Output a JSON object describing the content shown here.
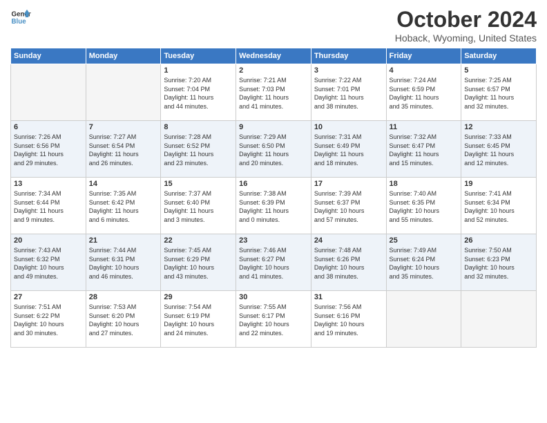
{
  "header": {
    "logo_general": "General",
    "logo_blue": "Blue",
    "month": "October 2024",
    "location": "Hoback, Wyoming, United States"
  },
  "weekdays": [
    "Sunday",
    "Monday",
    "Tuesday",
    "Wednesday",
    "Thursday",
    "Friday",
    "Saturday"
  ],
  "weeks": [
    [
      {
        "day": "",
        "sunrise": "",
        "sunset": "",
        "daylight": "",
        "empty": true
      },
      {
        "day": "",
        "sunrise": "",
        "sunset": "",
        "daylight": "",
        "empty": true
      },
      {
        "day": "1",
        "sunrise": "Sunrise: 7:20 AM",
        "sunset": "Sunset: 7:04 PM",
        "daylight": "Daylight: 11 hours and 44 minutes."
      },
      {
        "day": "2",
        "sunrise": "Sunrise: 7:21 AM",
        "sunset": "Sunset: 7:03 PM",
        "daylight": "Daylight: 11 hours and 41 minutes."
      },
      {
        "day": "3",
        "sunrise": "Sunrise: 7:22 AM",
        "sunset": "Sunset: 7:01 PM",
        "daylight": "Daylight: 11 hours and 38 minutes."
      },
      {
        "day": "4",
        "sunrise": "Sunrise: 7:24 AM",
        "sunset": "Sunset: 6:59 PM",
        "daylight": "Daylight: 11 hours and 35 minutes."
      },
      {
        "day": "5",
        "sunrise": "Sunrise: 7:25 AM",
        "sunset": "Sunset: 6:57 PM",
        "daylight": "Daylight: 11 hours and 32 minutes."
      }
    ],
    [
      {
        "day": "6",
        "sunrise": "Sunrise: 7:26 AM",
        "sunset": "Sunset: 6:56 PM",
        "daylight": "Daylight: 11 hours and 29 minutes."
      },
      {
        "day": "7",
        "sunrise": "Sunrise: 7:27 AM",
        "sunset": "Sunset: 6:54 PM",
        "daylight": "Daylight: 11 hours and 26 minutes."
      },
      {
        "day": "8",
        "sunrise": "Sunrise: 7:28 AM",
        "sunset": "Sunset: 6:52 PM",
        "daylight": "Daylight: 11 hours and 23 minutes."
      },
      {
        "day": "9",
        "sunrise": "Sunrise: 7:29 AM",
        "sunset": "Sunset: 6:50 PM",
        "daylight": "Daylight: 11 hours and 20 minutes."
      },
      {
        "day": "10",
        "sunrise": "Sunrise: 7:31 AM",
        "sunset": "Sunset: 6:49 PM",
        "daylight": "Daylight: 11 hours and 18 minutes."
      },
      {
        "day": "11",
        "sunrise": "Sunrise: 7:32 AM",
        "sunset": "Sunset: 6:47 PM",
        "daylight": "Daylight: 11 hours and 15 minutes."
      },
      {
        "day": "12",
        "sunrise": "Sunrise: 7:33 AM",
        "sunset": "Sunset: 6:45 PM",
        "daylight": "Daylight: 11 hours and 12 minutes."
      }
    ],
    [
      {
        "day": "13",
        "sunrise": "Sunrise: 7:34 AM",
        "sunset": "Sunset: 6:44 PM",
        "daylight": "Daylight: 11 hours and 9 minutes."
      },
      {
        "day": "14",
        "sunrise": "Sunrise: 7:35 AM",
        "sunset": "Sunset: 6:42 PM",
        "daylight": "Daylight: 11 hours and 6 minutes."
      },
      {
        "day": "15",
        "sunrise": "Sunrise: 7:37 AM",
        "sunset": "Sunset: 6:40 PM",
        "daylight": "Daylight: 11 hours and 3 minutes."
      },
      {
        "day": "16",
        "sunrise": "Sunrise: 7:38 AM",
        "sunset": "Sunset: 6:39 PM",
        "daylight": "Daylight: 11 hours and 0 minutes."
      },
      {
        "day": "17",
        "sunrise": "Sunrise: 7:39 AM",
        "sunset": "Sunset: 6:37 PM",
        "daylight": "Daylight: 10 hours and 57 minutes."
      },
      {
        "day": "18",
        "sunrise": "Sunrise: 7:40 AM",
        "sunset": "Sunset: 6:35 PM",
        "daylight": "Daylight: 10 hours and 55 minutes."
      },
      {
        "day": "19",
        "sunrise": "Sunrise: 7:41 AM",
        "sunset": "Sunset: 6:34 PM",
        "daylight": "Daylight: 10 hours and 52 minutes."
      }
    ],
    [
      {
        "day": "20",
        "sunrise": "Sunrise: 7:43 AM",
        "sunset": "Sunset: 6:32 PM",
        "daylight": "Daylight: 10 hours and 49 minutes."
      },
      {
        "day": "21",
        "sunrise": "Sunrise: 7:44 AM",
        "sunset": "Sunset: 6:31 PM",
        "daylight": "Daylight: 10 hours and 46 minutes."
      },
      {
        "day": "22",
        "sunrise": "Sunrise: 7:45 AM",
        "sunset": "Sunset: 6:29 PM",
        "daylight": "Daylight: 10 hours and 43 minutes."
      },
      {
        "day": "23",
        "sunrise": "Sunrise: 7:46 AM",
        "sunset": "Sunset: 6:27 PM",
        "daylight": "Daylight: 10 hours and 41 minutes."
      },
      {
        "day": "24",
        "sunrise": "Sunrise: 7:48 AM",
        "sunset": "Sunset: 6:26 PM",
        "daylight": "Daylight: 10 hours and 38 minutes."
      },
      {
        "day": "25",
        "sunrise": "Sunrise: 7:49 AM",
        "sunset": "Sunset: 6:24 PM",
        "daylight": "Daylight: 10 hours and 35 minutes."
      },
      {
        "day": "26",
        "sunrise": "Sunrise: 7:50 AM",
        "sunset": "Sunset: 6:23 PM",
        "daylight": "Daylight: 10 hours and 32 minutes."
      }
    ],
    [
      {
        "day": "27",
        "sunrise": "Sunrise: 7:51 AM",
        "sunset": "Sunset: 6:22 PM",
        "daylight": "Daylight: 10 hours and 30 minutes."
      },
      {
        "day": "28",
        "sunrise": "Sunrise: 7:53 AM",
        "sunset": "Sunset: 6:20 PM",
        "daylight": "Daylight: 10 hours and 27 minutes."
      },
      {
        "day": "29",
        "sunrise": "Sunrise: 7:54 AM",
        "sunset": "Sunset: 6:19 PM",
        "daylight": "Daylight: 10 hours and 24 minutes."
      },
      {
        "day": "30",
        "sunrise": "Sunrise: 7:55 AM",
        "sunset": "Sunset: 6:17 PM",
        "daylight": "Daylight: 10 hours and 22 minutes."
      },
      {
        "day": "31",
        "sunrise": "Sunrise: 7:56 AM",
        "sunset": "Sunset: 6:16 PM",
        "daylight": "Daylight: 10 hours and 19 minutes."
      },
      {
        "day": "",
        "sunrise": "",
        "sunset": "",
        "daylight": "",
        "empty": true
      },
      {
        "day": "",
        "sunrise": "",
        "sunset": "",
        "daylight": "",
        "empty": true
      }
    ]
  ]
}
